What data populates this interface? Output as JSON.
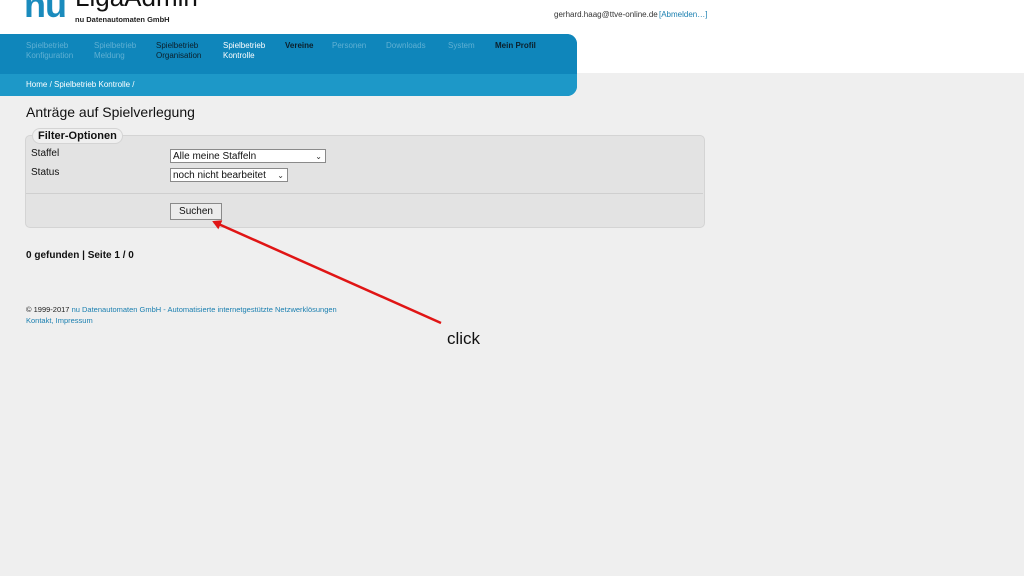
{
  "header": {
    "logo_nu": "nu",
    "logo_title": "LigaAdmin",
    "logo_sub": "nu Datenautomaten GmbH",
    "user_email": "gerhard.haag@ttve-online.de",
    "logout_label": "[Abmelden…]"
  },
  "nav": {
    "items": [
      {
        "line1": "Spielbetrieb",
        "line2": "Konfiguration"
      },
      {
        "line1": "Spielbetrieb",
        "line2": "Meldung"
      },
      {
        "line1": "Spielbetrieb",
        "line2": "Organisation"
      },
      {
        "line1": "Spielbetrieb",
        "line2": "Kontrolle"
      },
      {
        "line1": "Vereine",
        "line2": ""
      },
      {
        "line1": "Personen",
        "line2": ""
      },
      {
        "line1": "Downloads",
        "line2": ""
      },
      {
        "line1": "System",
        "line2": ""
      },
      {
        "line1": "Mein Profil",
        "line2": ""
      }
    ],
    "breadcrumb": "Home / Spielbetrieb Kontrolle /"
  },
  "page": {
    "title": "Anträge auf Spielverlegung"
  },
  "filter": {
    "legend": "Filter-Optionen",
    "staffel_label": "Staffel",
    "staffel_value": "Alle meine Staffeln",
    "status_label": "Status",
    "status_value": "noch nicht bearbeitet",
    "search_label": "Suchen"
  },
  "results": {
    "summary": "0 gefunden | Seite 1 / 0"
  },
  "footer": {
    "copyright": "© 1999-2017",
    "company": "nu Datenautomaten GmbH - Automatisierte internetgestützte Netzwerklösungen",
    "kontakt": "Kontakt",
    "separator": ", ",
    "impressum": "Impressum"
  },
  "annotation": {
    "label": "click",
    "arrow_color": "#e01515"
  },
  "colors": {
    "brand_blue": "#0e84b8",
    "background": "#efefef"
  }
}
